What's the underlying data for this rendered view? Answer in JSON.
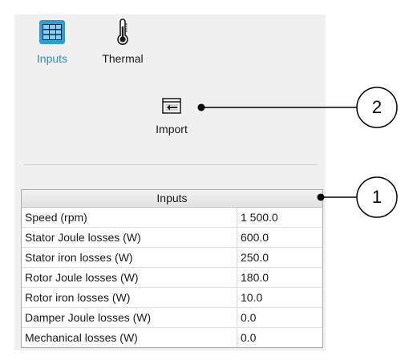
{
  "tabs": [
    {
      "label": "Inputs",
      "icon": "table-grid-icon",
      "color": "#1a93c9",
      "selected": true
    },
    {
      "label": "Thermal",
      "icon": "thermometer-icon",
      "color": "#1a1a1a",
      "selected": false
    }
  ],
  "import_button": {
    "label": "Import",
    "icon": "import-arrow-icon"
  },
  "table": {
    "title": "Inputs",
    "rows": [
      {
        "label": "Speed (rpm)",
        "value": "1 500.0"
      },
      {
        "label": "Stator Joule losses (W)",
        "value": "600.0"
      },
      {
        "label": "Stator iron losses (W)",
        "value": "250.0"
      },
      {
        "label": "Rotor Joule losses (W)",
        "value": "180.0"
      },
      {
        "label": "Rotor iron losses (W)",
        "value": "10.0"
      },
      {
        "label": "Damper Joule losses (W)",
        "value": "0.0"
      },
      {
        "label": "Mechanical losses (W)",
        "value": "0.0"
      }
    ]
  },
  "callouts": [
    "2",
    "1"
  ],
  "colors": {
    "accent": "#1a93c9",
    "panel_background": "#f0f0f0"
  }
}
